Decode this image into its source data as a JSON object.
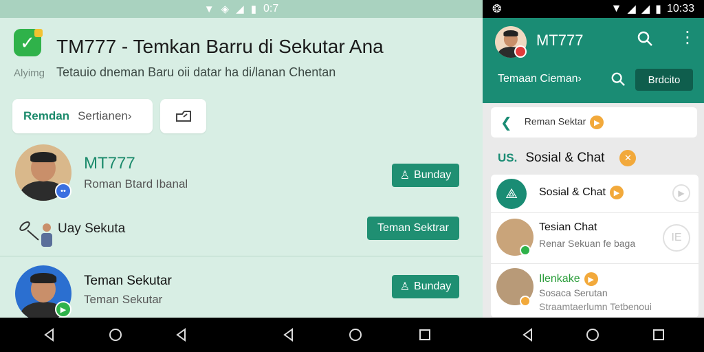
{
  "left": {
    "status": {
      "time": "0:7"
    },
    "app_logo_caption": "Alyimg",
    "title": "TM777 - Temkan Barru di Sekutar Ana",
    "subtitle": "Tetauio dneman Baru oii datar ha di/lanan Chentan",
    "search_card": {
      "primary": "Remdan",
      "secondary": "Sertianen›"
    },
    "rows": [
      {
        "name": "MT777",
        "sub": "Roman Btard Ibanal",
        "button": "Bunday"
      },
      {
        "text": "Uay Sekuta",
        "button": "Teman Sektrar"
      },
      {
        "name": "Teman Sekutar",
        "sub": "Teman Sekutar",
        "button": "Bunday"
      }
    ]
  },
  "right": {
    "status": {
      "time": "10:33"
    },
    "appbar": {
      "title": "MT777",
      "tab": "Temaan Cieman›",
      "button": "Brdcito"
    },
    "card1_label": "Reman Sektar",
    "section": {
      "tag": "US.",
      "title": "Sosial & Chat"
    },
    "list": [
      {
        "title": "Sosial & Chat"
      },
      {
        "title": "Tesian Chat",
        "sub": "Renar Sekuan fe baga",
        "icon_text": "IE"
      },
      {
        "title": "Ilenkake",
        "sub": "Sosaca Serutan",
        "sub2": "Straamtaerlumn Tetbenoui"
      }
    ]
  },
  "colors": {
    "accent": "#1a8c74",
    "brand_green": "#2fb24a",
    "badge_orange": "#f2a93b",
    "left_bg": "#d8eee4"
  },
  "icons": [
    "wifi-icon",
    "signal-icon",
    "battery-icon",
    "search-icon",
    "more-vert-icon",
    "share-icon",
    "back-arrow-icon",
    "nav-back-icon",
    "nav-home-icon",
    "nav-recents-icon"
  ]
}
